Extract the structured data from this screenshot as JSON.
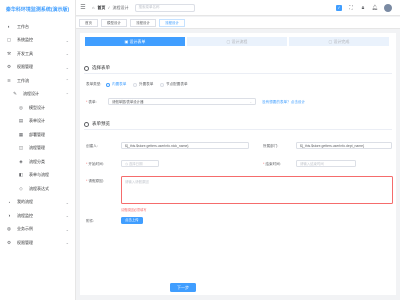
{
  "app": {
    "title": "秦华科环境监测系统(演示版)"
  },
  "sidebar": {
    "items": [
      {
        "label": "工作台",
        "icon": "workbench-icon"
      },
      {
        "label": "系统监控",
        "icon": "monitor-icon"
      },
      {
        "label": "开发工具",
        "icon": "tool-icon"
      },
      {
        "label": "权限管理",
        "icon": "permission-icon"
      },
      {
        "label": "工作流",
        "icon": "workflow-icon"
      },
      {
        "label": "流程设计",
        "icon": "design-icon"
      },
      {
        "label": "模型设计",
        "icon": "model-icon"
      },
      {
        "label": "表单设计",
        "icon": "form-icon"
      },
      {
        "label": "部署管理",
        "icon": "deploy-icon"
      },
      {
        "label": "流程管理",
        "icon": "process-icon"
      },
      {
        "label": "流程分类",
        "icon": "category-icon"
      },
      {
        "label": "表单与流程",
        "icon": "form-process-icon"
      },
      {
        "label": "流程表达式",
        "icon": "expression-icon"
      },
      {
        "label": "我的流程",
        "icon": "my-process-icon"
      },
      {
        "label": "流程监控",
        "icon": "process-monitor-icon"
      },
      {
        "label": "业务示例",
        "icon": "example-icon"
      },
      {
        "label": "权限管理",
        "icon": "permission-icon"
      }
    ]
  },
  "header": {
    "crumb_home": "首页",
    "crumb_current": "流程设计",
    "search_placeholder": "搜索菜单名称"
  },
  "tabs": [
    "首页",
    "模型设计",
    "流程设计",
    "流程设计"
  ],
  "steps": [
    "设计表单",
    "设计流程",
    "设计完成"
  ],
  "form": {
    "section1_title": "选择表单",
    "form_type_label": "表单类型:",
    "radio_options": [
      "内置表单",
      "外置表单",
      "节点配置表单"
    ],
    "form_label": "表单:",
    "form_value": "请假单据/表单设计器",
    "form_link": "没有想要的表单？点击设计",
    "section2_title": "表单预览",
    "creator_label": "创建人:",
    "creator_value": "${_this.$store.getters.userInfo.nick_name}",
    "dept_label": "所属部门:",
    "dept_value": "${_this.$store.getters.userInfo.dept_name}",
    "start_time_label": "开始时间:",
    "start_time_placeholder": "选择日期",
    "end_time_label": "结束时间:",
    "end_time_placeholder": "请输入结束时间",
    "reason_label": "请假原因:",
    "reason_placeholder": "请输入请假原因",
    "reason_error": "请假原因必须填写",
    "attachment_label": "附件:",
    "upload_label": "点击上传",
    "next_label": "下一步"
  }
}
